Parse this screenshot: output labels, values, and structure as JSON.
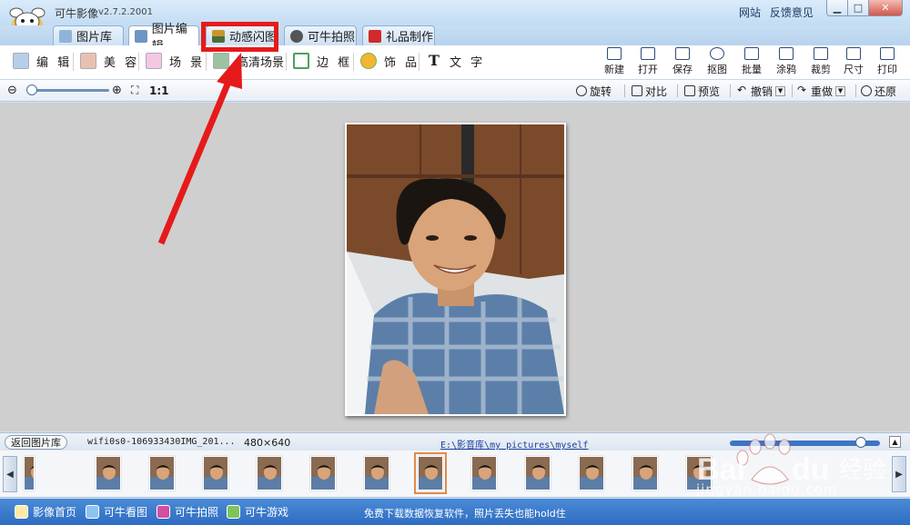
{
  "window": {
    "app_name": "可牛影像",
    "version": "v2.7.2.2001",
    "top_links": [
      "网站",
      "反馈意见"
    ],
    "controls": [
      "minimize-icon",
      "maximize-icon",
      "close-icon"
    ]
  },
  "main_tabs": [
    {
      "label": "图片库",
      "icon": "gallery-icon"
    },
    {
      "label": "图片编辑",
      "icon": "edit-icon"
    },
    {
      "label": "动感闪图",
      "icon": "film-icon",
      "highlighted": true
    },
    {
      "label": "可牛拍照",
      "icon": "webcam-icon"
    },
    {
      "label": "礼品制作",
      "icon": "gift-icon"
    }
  ],
  "toolbar": {
    "tools": [
      {
        "label": "编 辑",
        "icon": "picture-edit-icon"
      },
      {
        "label": "美 容",
        "icon": "face-icon"
      },
      {
        "label": "场 景",
        "icon": "scene-icon"
      },
      {
        "label": "高清场景",
        "icon": "hd-scene-icon"
      },
      {
        "label": "边 框",
        "icon": "frame-icon"
      },
      {
        "label": "饰 品",
        "icon": "ornament-icon"
      },
      {
        "label": "文 字",
        "icon": "text-icon"
      }
    ],
    "actions": [
      "新建",
      "打开",
      "保存",
      "抠图",
      "批量",
      "涂鸦",
      "裁剪",
      "尺寸",
      "打印"
    ]
  },
  "subbar": {
    "zoom_label": "1:1",
    "zoom_level": 0.0,
    "buttons": [
      {
        "label": "旋转",
        "icon": "rotate-icon"
      },
      {
        "label": "对比",
        "icon": "compare-icon"
      },
      {
        "label": "预览",
        "icon": "preview-icon"
      },
      {
        "label": "撤销",
        "icon": "undo-icon",
        "dropdown": true
      },
      {
        "label": "重做",
        "icon": "redo-icon",
        "dropdown": true
      },
      {
        "label": "还原",
        "icon": "restore-icon"
      }
    ]
  },
  "status": {
    "back_label": "返回图片库",
    "filename": "wifi0s0-106933430IMG_201...",
    "dimensions": "480×640",
    "path": "E:\\影音库\\my pictures\\myself",
    "thumb_size_level": 0.9
  },
  "filmstrip": {
    "thumb_count": 13,
    "selected_index": 7,
    "arrows": [
      "left-arrow-icon",
      "right-arrow-icon"
    ]
  },
  "bottom_links": [
    "影像首页",
    "可牛看图",
    "可牛拍照",
    "可牛游戏"
  ],
  "bottom_ad": "免费下载数据恢复软件，照片丢失也能hold住",
  "watermark": {
    "logo": "Bai 经验",
    "url": "jingyan.baidu.com"
  },
  "colors": {
    "accent": "#2e6cc2",
    "highlight": "#e61a1a",
    "selection": "#e08a4a"
  }
}
